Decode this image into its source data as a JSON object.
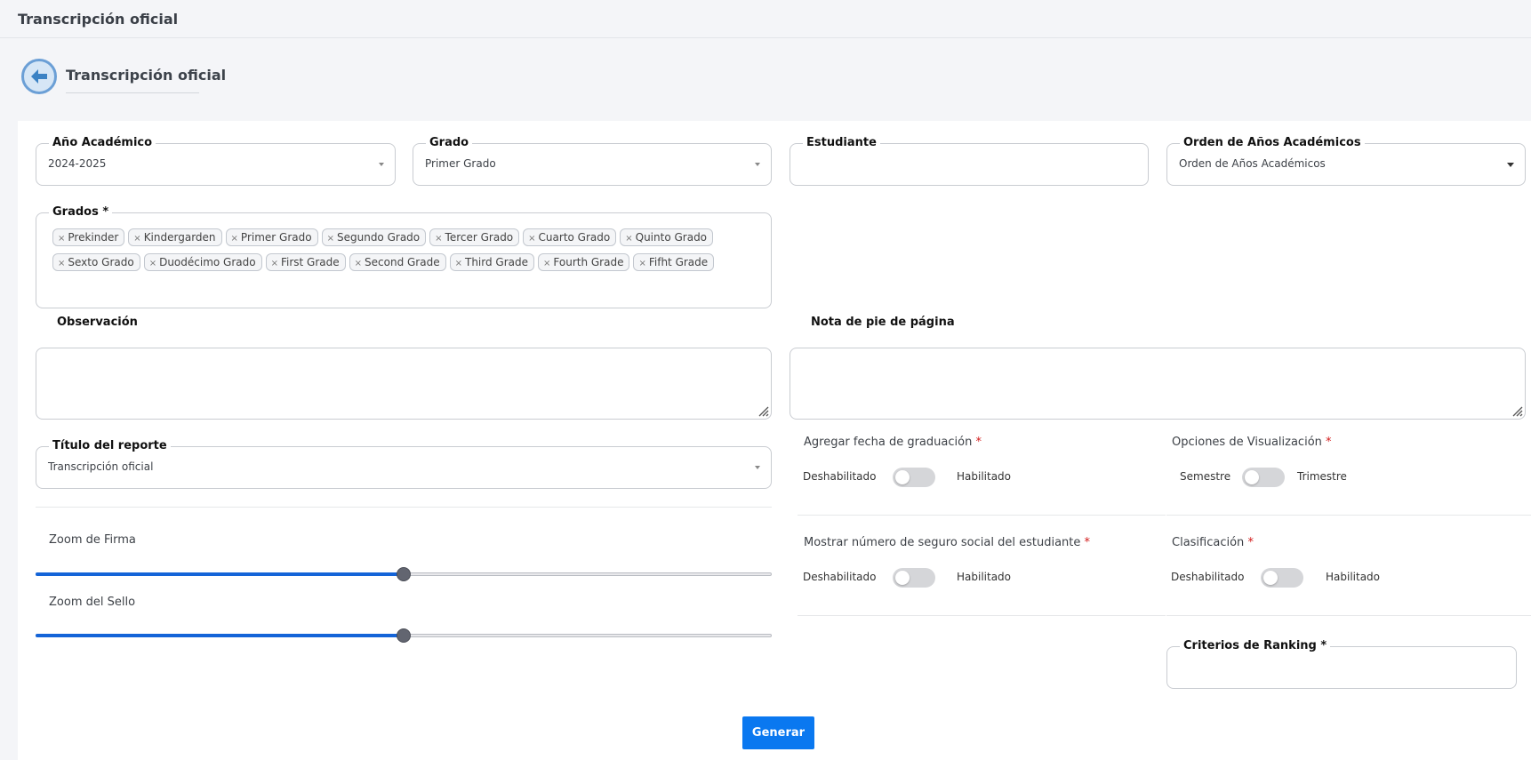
{
  "topbar": {
    "title": "Transcripción oficial"
  },
  "page": {
    "title": "Transcripción oficial"
  },
  "form": {
    "academic_year": {
      "label": "Año Académico",
      "value": "2024-2025"
    },
    "grade": {
      "label": "Grado",
      "value": "Primer Grado"
    },
    "student": {
      "label": "Estudiante",
      "value": ""
    },
    "year_order": {
      "label": "Orden de Años Académicos",
      "value": "Orden de Años Académicos"
    },
    "grades": {
      "label": "Grados *",
      "tags": [
        "Prekinder",
        "Kindergarden",
        "Primer Grado",
        "Segundo Grado",
        "Tercer Grado",
        "Cuarto Grado",
        "Quinto Grado",
        "Sexto Grado",
        "Duodécimo Grado",
        "First Grade",
        "Second Grade",
        "Third Grade",
        "Fourth Grade",
        "Fifht Grade"
      ]
    },
    "observation": {
      "label": "Observación",
      "value": ""
    },
    "footnote": {
      "label": "Nota de pie de página",
      "value": ""
    },
    "report_title": {
      "label": "Título del reporte",
      "value": "Transcripción oficial"
    },
    "graduation_date": {
      "label": "Agregar fecha de graduación",
      "required": "*",
      "off_label": "Deshabilitado",
      "on_label": "Habilitado",
      "enabled": false
    },
    "display_options": {
      "label": "Opciones de Visualización",
      "required": "*",
      "off_label": "Semestre",
      "on_label": "Trimestre",
      "enabled": false
    },
    "ssn": {
      "label": "Mostrar número de seguro social del estudiante",
      "required": "*",
      "off_label": "Deshabilitado",
      "on_label": "Habilitado",
      "enabled": false
    },
    "ranking": {
      "label": "Clasificación",
      "required": "*",
      "off_label": "Deshabilitado",
      "on_label": "Habilitado",
      "enabled": false
    },
    "ranking_criteria": {
      "label": "Criterios de Ranking *",
      "value": ""
    },
    "signature_zoom": {
      "label": "Zoom de Firma",
      "value_percent": 50
    },
    "seal_zoom": {
      "label": "Zoom del Sello",
      "value_percent": 50
    },
    "submit_label": "Generar"
  },
  "icons": {
    "back": "arrow-left-circle-icon",
    "clear_tag": "x-icon",
    "dropdown": "caret-down-icon",
    "resize": "resize-grip-icon"
  },
  "colors": {
    "primary": "#0a78f0",
    "slider_fill": "#1464d8",
    "back_icon": "#3b82c4",
    "required": "#d21b1b"
  }
}
